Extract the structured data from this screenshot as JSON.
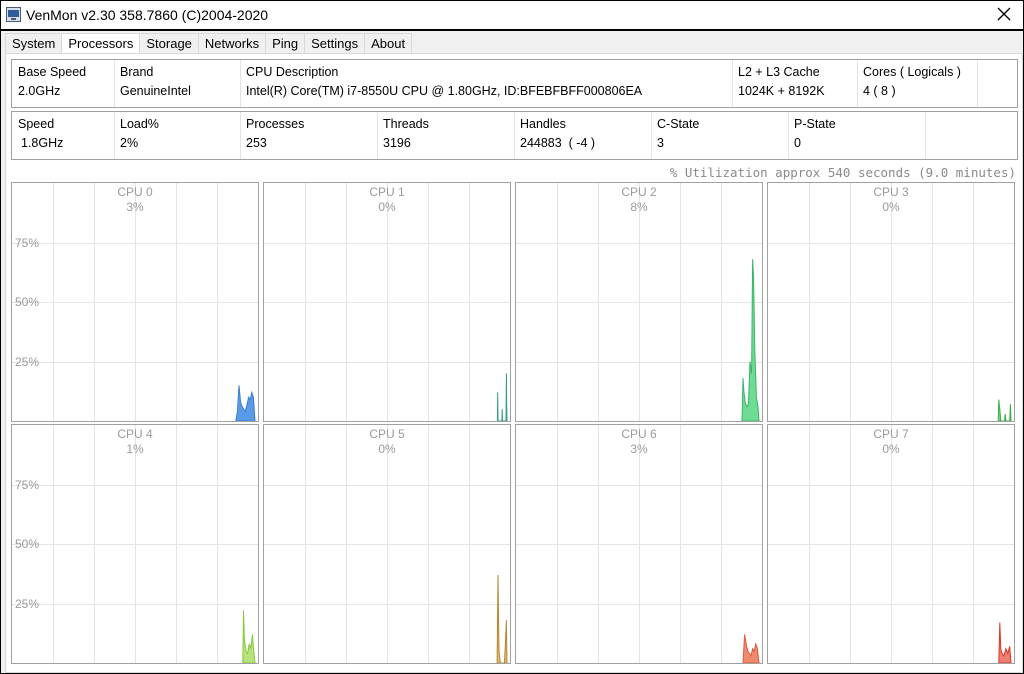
{
  "window": {
    "title": "VenMon v2.30 358.7860 (C)2004-2020"
  },
  "tabs": [
    {
      "label": "System",
      "active": false
    },
    {
      "label": "Processors",
      "active": true
    },
    {
      "label": "Storage",
      "active": false
    },
    {
      "label": "Networks",
      "active": false
    },
    {
      "label": "Ping",
      "active": false
    },
    {
      "label": "Settings",
      "active": false
    },
    {
      "label": "About",
      "active": false
    }
  ],
  "info1": {
    "base_speed": {
      "label": "Base Speed",
      "value": "2.0GHz"
    },
    "brand": {
      "label": "Brand",
      "value": "GenuineIntel"
    },
    "cpu_desc": {
      "label": "CPU Description",
      "value": "Intel(R) Core(TM) i7-8550U CPU @ 1.80GHz, ID:BFEBFBFF000806EA"
    },
    "cache": {
      "label": "L2 + L3 Cache",
      "value": "1024K + 8192K"
    },
    "cores": {
      "label": "Cores ( Logicals )",
      "value": "4 ( 8 )"
    }
  },
  "info2": {
    "speed": {
      "label": "Speed",
      "value": "1.8GHz"
    },
    "load": {
      "label": "Load%",
      "value": "2%"
    },
    "processes": {
      "label": "Processes",
      "value": "253"
    },
    "threads": {
      "label": "Threads",
      "value": "3196"
    },
    "handles": {
      "label": "Handles",
      "value": "244883  ( -4 )"
    },
    "cstate": {
      "label": "C-State",
      "value": "3"
    },
    "pstate": {
      "label": "P-State",
      "value": "0"
    }
  },
  "utilization_note": "% Utilization approx 540 seconds (9.0 minutes)",
  "axis_labels": [
    "75%",
    "50%",
    "25%"
  ],
  "cpus": [
    {
      "name": "CPU 0",
      "pct": "3%",
      "color": "#3a7ed6",
      "fill": "#5b9be6",
      "trace": [
        [
          0,
          0
        ],
        [
          0.5,
          4
        ],
        [
          1,
          15
        ],
        [
          1.5,
          8
        ],
        [
          2,
          6
        ],
        [
          2.5,
          5
        ],
        [
          3,
          4
        ],
        [
          3.5,
          7
        ],
        [
          4,
          10
        ],
        [
          4.5,
          9
        ],
        [
          5,
          12
        ],
        [
          5.5,
          10
        ],
        [
          6,
          0
        ]
      ]
    },
    {
      "name": "CPU 1",
      "pct": "0%",
      "color": "#2e9e80",
      "fill": "#8fd7c3",
      "trace": [
        [
          0,
          0
        ],
        [
          0.1,
          0
        ],
        [
          0.2,
          12
        ],
        [
          0.3,
          0
        ],
        [
          1.5,
          0
        ],
        [
          1.6,
          5
        ],
        [
          1.7,
          0
        ],
        [
          2.8,
          0
        ],
        [
          2.9,
          20
        ],
        [
          3.0,
          6
        ],
        [
          3.1,
          0
        ]
      ]
    },
    {
      "name": "CPU 2",
      "pct": "8%",
      "color": "#3bb36a",
      "fill": "#6fdc93",
      "trace": [
        [
          0,
          0
        ],
        [
          0.3,
          18
        ],
        [
          0.6,
          12
        ],
        [
          1,
          8
        ],
        [
          1.5,
          6
        ],
        [
          2,
          7
        ],
        [
          2.5,
          25
        ],
        [
          3,
          20
        ],
        [
          3.3,
          68
        ],
        [
          3.6,
          60
        ],
        [
          4,
          30
        ],
        [
          4.5,
          10
        ],
        [
          5,
          6
        ],
        [
          5.3,
          0
        ]
      ]
    },
    {
      "name": "CPU 3",
      "pct": "0%",
      "color": "#3bae4a",
      "fill": "#7ccf83",
      "trace": [
        [
          0,
          0
        ],
        [
          0.2,
          9
        ],
        [
          0.5,
          5
        ],
        [
          0.8,
          0
        ],
        [
          2,
          0
        ],
        [
          2.2,
          3
        ],
        [
          2.4,
          0
        ],
        [
          3.6,
          0
        ],
        [
          3.8,
          7
        ],
        [
          4.0,
          0
        ]
      ]
    },
    {
      "name": "CPU 4",
      "pct": "1%",
      "color": "#86c83a",
      "fill": "#b6e37b",
      "trace": [
        [
          0,
          0
        ],
        [
          0.2,
          22
        ],
        [
          0.5,
          10
        ],
        [
          1,
          5
        ],
        [
          1.5,
          4
        ],
        [
          2,
          8
        ],
        [
          2.5,
          6
        ],
        [
          3,
          12
        ],
        [
          3.4,
          5
        ],
        [
          3.8,
          0
        ]
      ]
    },
    {
      "name": "CPU 5",
      "pct": "0%",
      "color": "#b8862c",
      "fill": "#e0bd78",
      "trace": [
        [
          0,
          0
        ],
        [
          0.3,
          37
        ],
        [
          0.6,
          5
        ],
        [
          1,
          0
        ],
        [
          2.3,
          0
        ],
        [
          2.6,
          8
        ],
        [
          2.9,
          18
        ],
        [
          3.1,
          0
        ]
      ]
    },
    {
      "name": "CPU 6",
      "pct": "3%",
      "color": "#e0593a",
      "fill": "#f08a6e",
      "trace": [
        [
          0,
          0
        ],
        [
          0.5,
          12
        ],
        [
          1,
          8
        ],
        [
          1.5,
          5
        ],
        [
          2,
          4
        ],
        [
          2.5,
          3
        ],
        [
          3,
          6
        ],
        [
          3.5,
          5
        ],
        [
          4,
          8
        ],
        [
          4.5,
          6
        ],
        [
          5,
          0
        ]
      ]
    },
    {
      "name": "CPU 7",
      "pct": "0%",
      "color": "#d8382a",
      "fill": "#f07e72",
      "trace": [
        [
          0,
          0
        ],
        [
          0.3,
          17
        ],
        [
          0.6,
          6
        ],
        [
          1,
          4
        ],
        [
          1.6,
          3
        ],
        [
          2.2,
          6
        ],
        [
          2.8,
          4
        ],
        [
          3.4,
          7
        ],
        [
          3.8,
          0
        ]
      ]
    }
  ]
}
